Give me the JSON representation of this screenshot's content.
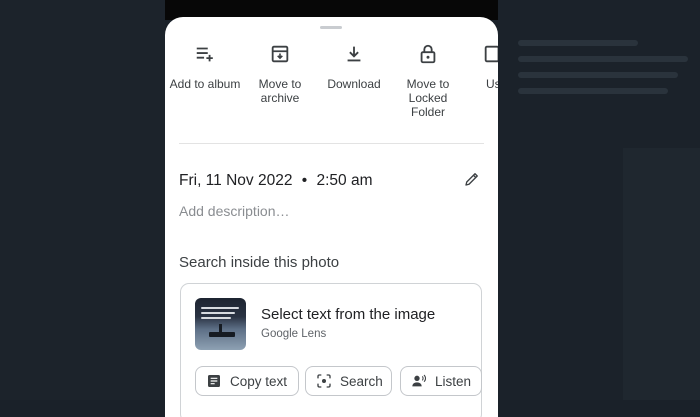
{
  "actions": [
    {
      "label": "Add to album",
      "icon": "playlist-add-icon"
    },
    {
      "label": "Move to archive",
      "icon": "archive-icon"
    },
    {
      "label": "Download",
      "icon": "download-icon"
    },
    {
      "label": "Move to Locked Folder",
      "icon": "lock-icon"
    },
    {
      "label": "Us",
      "icon": "use-as-icon"
    }
  ],
  "info": {
    "date": "Fri, 11 Nov 2022",
    "separator": "•",
    "time": "2:50 am",
    "description_placeholder": "Add description…"
  },
  "search_section": {
    "title": "Search inside this photo",
    "lens_title": "Select text from the image",
    "lens_subtitle": "Google Lens",
    "chips": [
      {
        "label": "Copy text",
        "icon": "copy-text-icon"
      },
      {
        "label": "Search",
        "icon": "lens-search-icon"
      },
      {
        "label": "Listen",
        "icon": "listen-icon"
      }
    ]
  },
  "colors": {
    "sheet_background": "#ffffff",
    "backdrop": "#1a2129",
    "text_primary": "#202124",
    "text_secondary": "#5f6368"
  }
}
